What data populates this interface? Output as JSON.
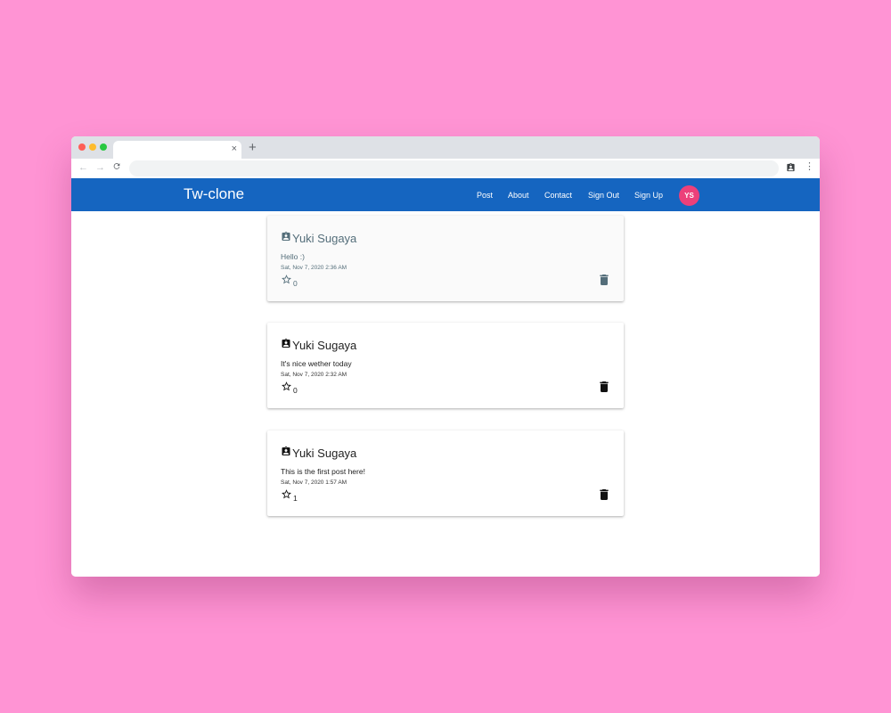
{
  "browser": {
    "tab_close": "×",
    "new_tab": "+",
    "back": "←",
    "forward": "→",
    "reload": "C",
    "menu": "⋮",
    "address": ""
  },
  "app": {
    "brand": "Tw-clone",
    "brand_color": "#1565c0",
    "nav": {
      "post": "Post",
      "about": "About",
      "contact": "Contact",
      "sign_out": "Sign Out",
      "sign_up": "Sign Up"
    },
    "avatar_initials": "YS",
    "avatar_color": "#ec407a"
  },
  "posts": [
    {
      "author": "Yuki Sugaya",
      "body": "Hello :)",
      "date": "Sat, Nov 7, 2020 2:36 AM",
      "likes": "0"
    },
    {
      "author": "Yuki Sugaya",
      "body": "It's nice wether today",
      "date": "Sat, Nov 7, 2020 2:32 AM",
      "likes": "0"
    },
    {
      "author": "Yuki Sugaya",
      "body": "This is the first post here!",
      "date": "Sat, Nov 7, 2020 1:57 AM",
      "likes": "1"
    }
  ]
}
